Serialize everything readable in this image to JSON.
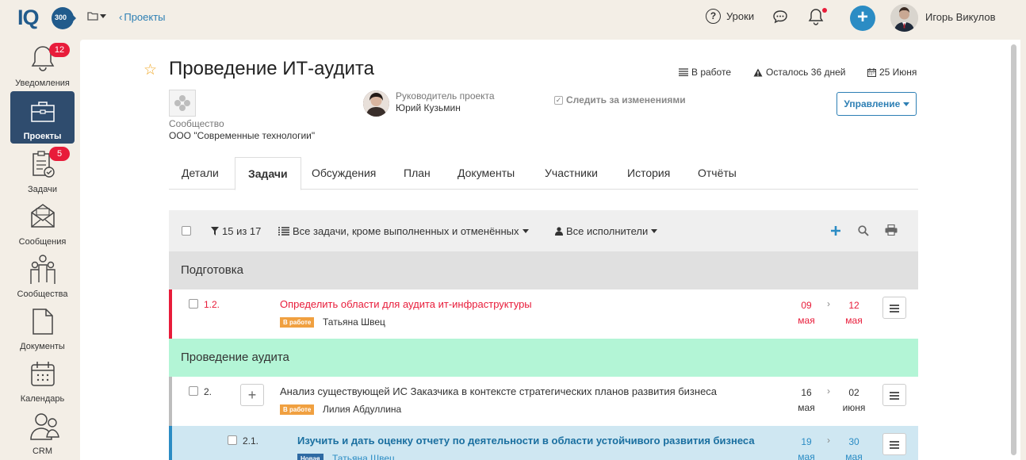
{
  "topbar": {
    "logo_text": "IQ",
    "logo_badge": "300",
    "breadcrumb": "Проекты",
    "lessons_label": "Уроки",
    "user_name": "Игорь Викулов",
    "add_symbol": "+"
  },
  "sidebar": {
    "items": [
      {
        "label": "Уведомления",
        "badge": "12",
        "icon": "bell-icon"
      },
      {
        "label": "Проекты",
        "icon": "briefcase-icon",
        "active": true
      },
      {
        "label": "Задачи",
        "badge": "5",
        "icon": "clipboard-icon"
      },
      {
        "label": "Сообщения",
        "icon": "envelope-icon"
      },
      {
        "label": "Сообщества",
        "icon": "people-icon"
      },
      {
        "label": "Документы",
        "icon": "document-icon"
      },
      {
        "label": "Календарь",
        "icon": "calendar-icon"
      },
      {
        "label": "CRM",
        "icon": "crm-icon"
      }
    ]
  },
  "project": {
    "title": "Проведение ИТ-аудита",
    "status": "В работе",
    "remaining": "Осталось 36 дней",
    "due": "25 Июня",
    "community_label": "Сообщество",
    "community_value": "ООО \"Современные технологии\"",
    "manager_label": "Руководитель проекта",
    "manager_value": "Юрий Кузьмин",
    "follow_label": "Следить за изменениями",
    "manage_label": "Управление"
  },
  "tabs": [
    {
      "label": "Детали"
    },
    {
      "label": "Задачи",
      "active": true
    },
    {
      "label": "Обсуждения"
    },
    {
      "label": "План"
    },
    {
      "label": "Документы"
    },
    {
      "label": "Участники"
    },
    {
      "label": "История"
    },
    {
      "label": "Отчёты"
    }
  ],
  "toolbar": {
    "count": "15 из 17",
    "filter": "Все задачи, кроме выполненных и отменённых",
    "assignees": "Все исполнители"
  },
  "groups": [
    {
      "name": "Подготовка",
      "color": "#e0e0e0"
    },
    {
      "name": "Проведение аудита",
      "color": "#b3f5d6"
    }
  ],
  "tasks": [
    {
      "num": "1.2.",
      "name": "Определить области для аудита ит-инфраструктуры",
      "status": "В работе",
      "status_color": "#f0a040",
      "assignee": "Татьяна Швец",
      "start_day": "09",
      "start_month": "мая",
      "end_day": "12",
      "end_month": "мая",
      "bar_color": "#e81c3a",
      "name_color": "#e81c3a"
    },
    {
      "num": "2.",
      "name": "Анализ существующей ИС Заказчика в контексте стратегических планов развития бизнеса",
      "status": "В работе",
      "status_color": "#f0a040",
      "assignee": "Лилия Абдуллина",
      "start_day": "16",
      "start_month": "мая",
      "end_day": "02",
      "end_month": "июня",
      "bar_color": "#bdbdbd",
      "name_color": "#333333"
    },
    {
      "num": "2.1.",
      "name": "Изучить и дать оценку отчету по деятельности в области устойчивого развития бизнеса",
      "status": "Новая",
      "status_color": "#2f6aa3",
      "assignee": "Татьяна Швец",
      "start_day": "19",
      "start_month": "мая",
      "end_day": "30",
      "end_month": "мая",
      "bar_color": "#2b8cc4",
      "name_color": "#1a6fa0"
    }
  ]
}
